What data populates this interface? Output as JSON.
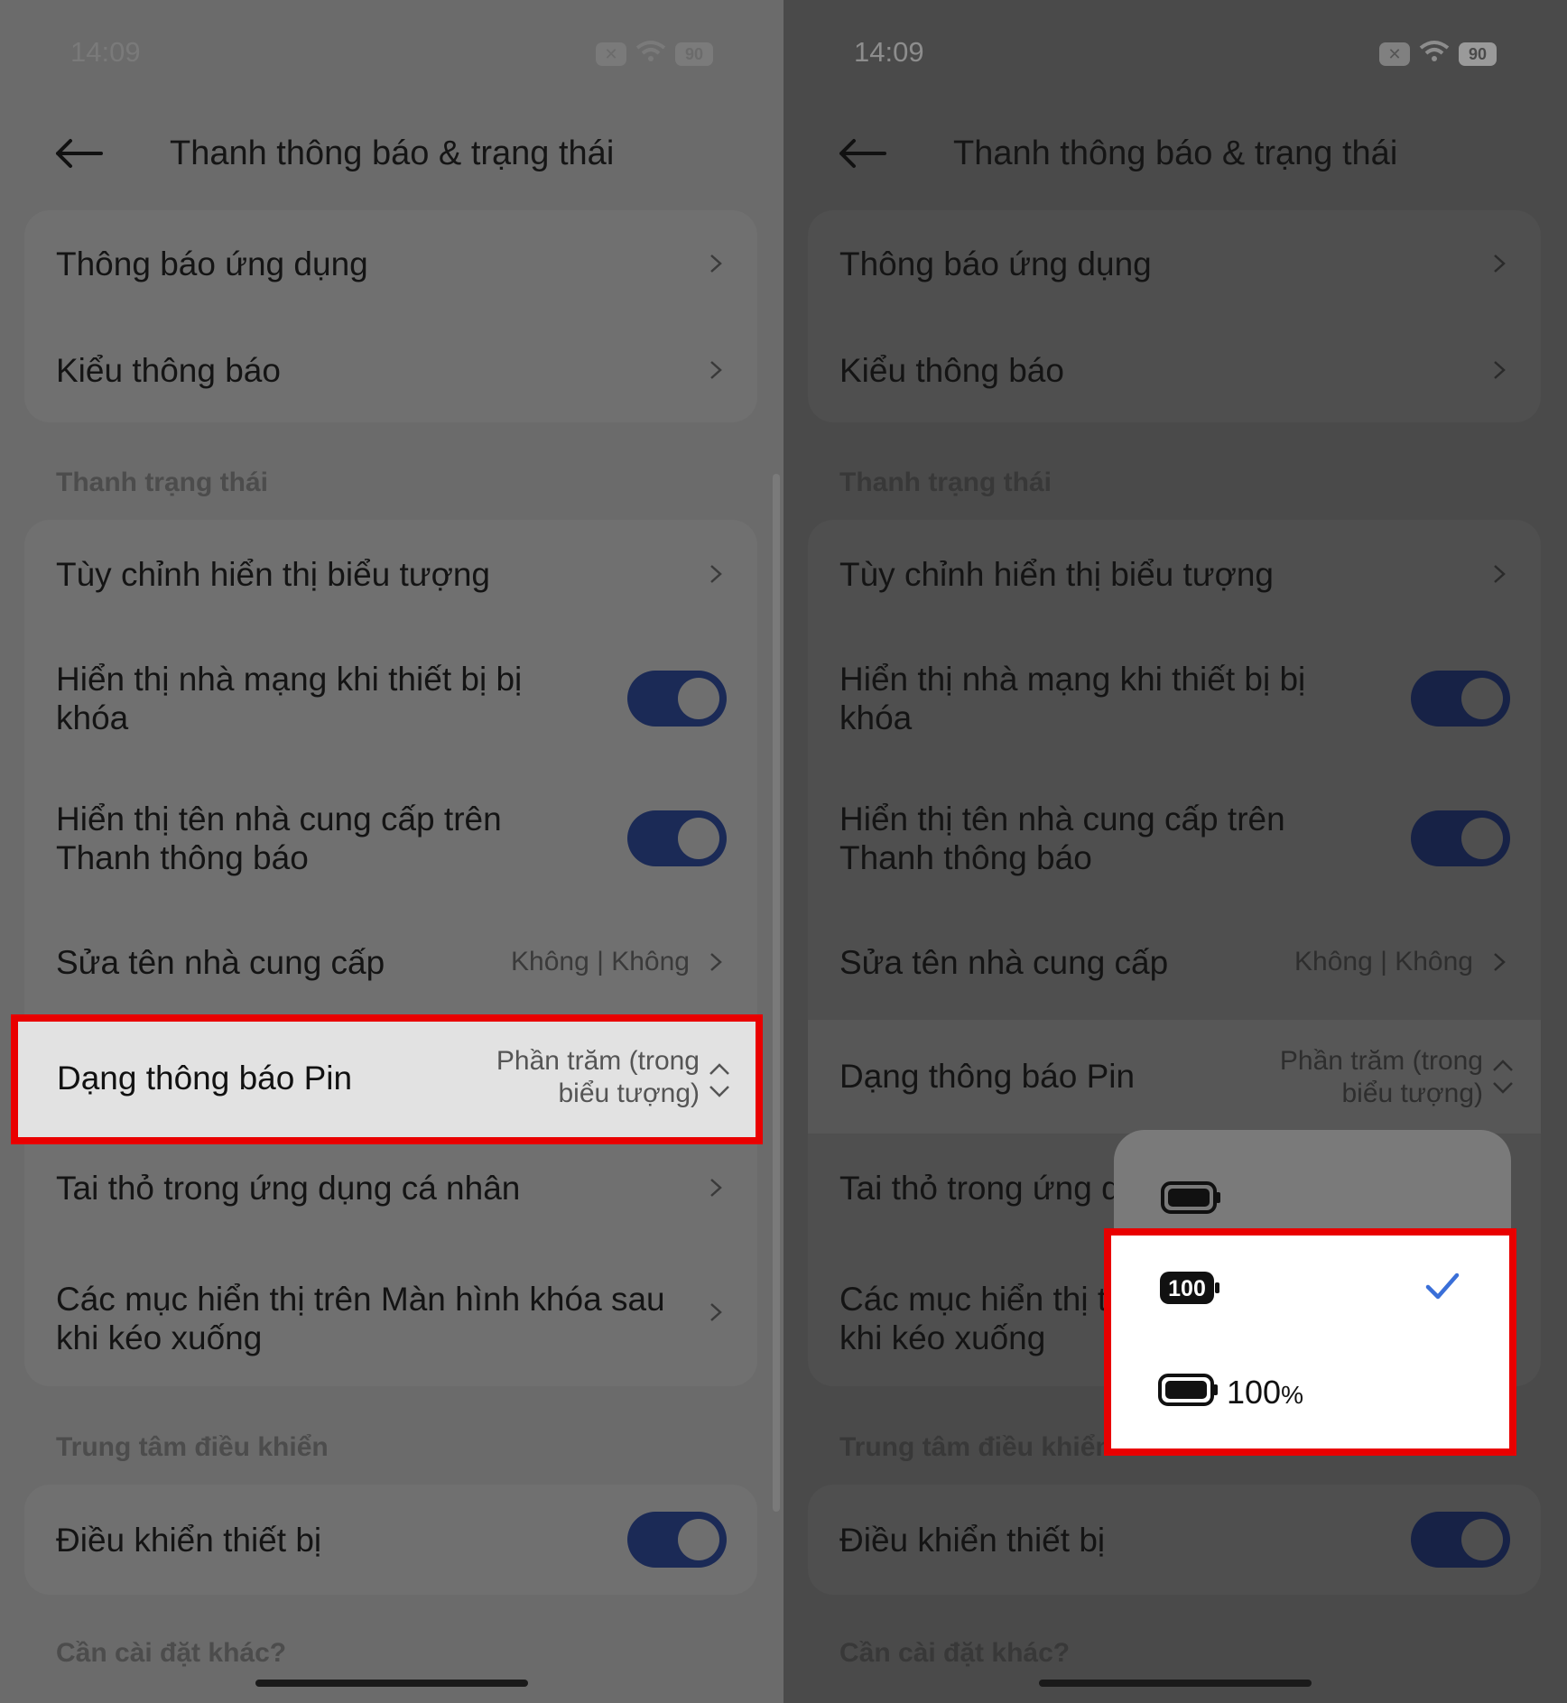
{
  "status": {
    "time": "14:09",
    "battery": "90"
  },
  "header": {
    "title": "Thanh thông báo & trạng thái"
  },
  "notifications_card": {
    "items": [
      {
        "label": "Thông báo ứng dụng"
      },
      {
        "label": "Kiểu thông báo"
      }
    ]
  },
  "section_status_bar": {
    "heading": "Thanh trạng thái"
  },
  "status_items": {
    "custom_icons": "Tùy chỉnh hiển thị biểu tượng",
    "show_carrier_locked": "Hiển thị nhà mạng khi thiết bị bị khóa",
    "show_provider_name": "Hiển thị tên nhà cung cấp trên Thanh thông báo",
    "edit_provider": "Sửa tên nhà cung cấp",
    "edit_provider_value": "Không | Không",
    "battery_style": "Dạng thông báo Pin",
    "battery_style_value_line1": "Phần trăm (trong",
    "battery_style_value_line2": "biểu tượng)",
    "notch": "Tai thỏ trong ứng dụng cá nhân",
    "notch_truncated": "Tai thỏ trong ứng d",
    "lock_screen_items_line1": "Các mục hiển thị trên Màn hình khóa sau",
    "lock_screen_items_line2": "khi kéo xuống",
    "lock_screen_items_truncated": "Các mục hiển thị t"
  },
  "section_control_center": {
    "heading": "Trung tâm điều khiển",
    "heading_truncated": "Trung tâm điều khiển",
    "device_control": "Điều khiển thiết bị"
  },
  "footer": {
    "more_settings": "Cần cài đặt khác?"
  },
  "toggles": {
    "show_carrier_locked": true,
    "show_provider_name": true,
    "device_control": true
  },
  "battery_popup": {
    "options": [
      {
        "name": "icon-only",
        "label": ""
      },
      {
        "name": "percentage-in-icon",
        "label": "100",
        "selected": true
      },
      {
        "name": "percentage-beside-icon",
        "label": "100",
        "suffix": "%"
      }
    ]
  },
  "colors": {
    "accent": "#1b2a56",
    "highlight": "#e90000",
    "check": "#3a6fd8"
  }
}
